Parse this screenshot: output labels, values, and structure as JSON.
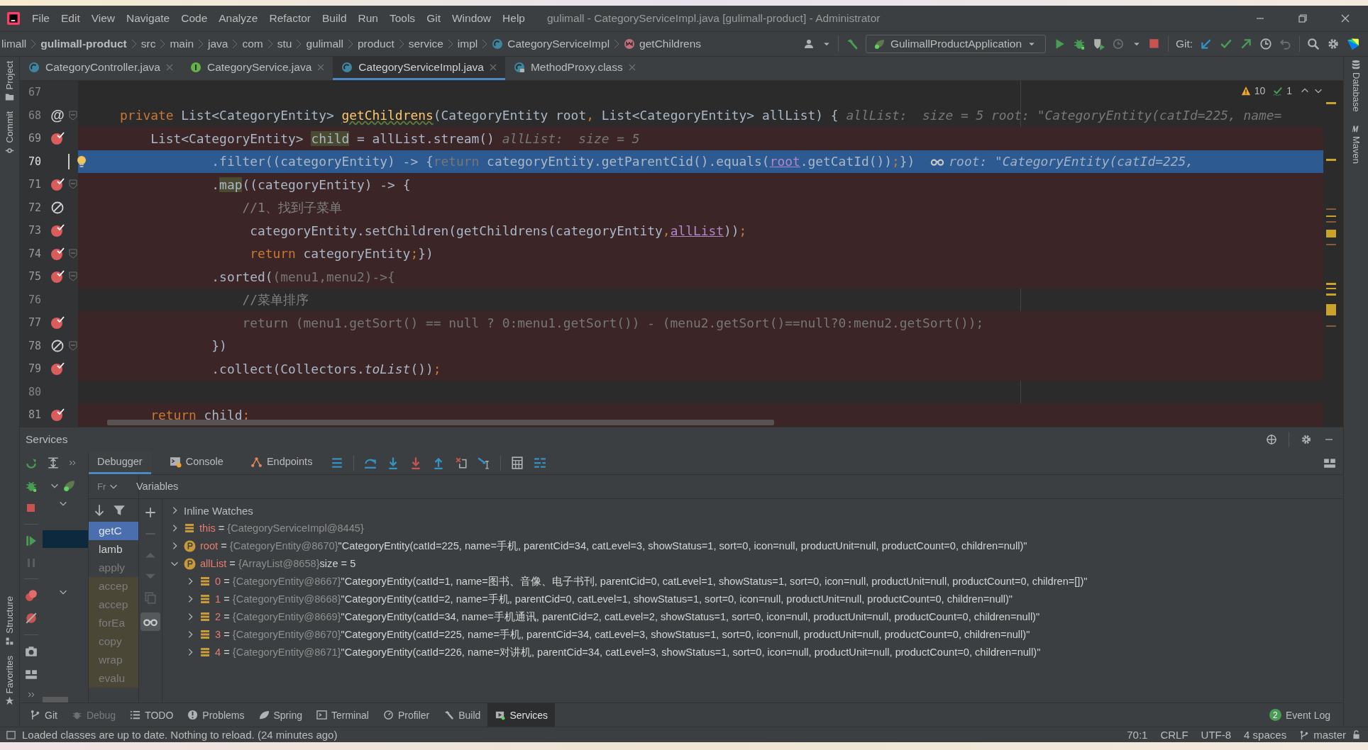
{
  "window": {
    "title": "gulimall - CategoryServiceImpl.java [gulimall-product] - Administrator"
  },
  "menu": [
    "File",
    "Edit",
    "View",
    "Navigate",
    "Code",
    "Analyze",
    "Refactor",
    "Build",
    "Run",
    "Tools",
    "Git",
    "Window",
    "Help"
  ],
  "breadcrumb": [
    {
      "label": "limall",
      "kind": "plain"
    },
    {
      "label": "gulimall-product",
      "kind": "module"
    },
    {
      "label": "src",
      "kind": "plain"
    },
    {
      "label": "main",
      "kind": "plain"
    },
    {
      "label": "java",
      "kind": "plain"
    },
    {
      "label": "com",
      "kind": "plain"
    },
    {
      "label": "stu",
      "kind": "plain"
    },
    {
      "label": "gulimall",
      "kind": "plain"
    },
    {
      "label": "product",
      "kind": "plain"
    },
    {
      "label": "service",
      "kind": "plain"
    },
    {
      "label": "impl",
      "kind": "plain"
    },
    {
      "label": "CategoryServiceImpl",
      "kind": "class"
    },
    {
      "label": "getChildrens",
      "kind": "method"
    }
  ],
  "run_config": "GulimallProductApplication",
  "git_label": "Git:",
  "left_tools": [
    "Project",
    "Commit"
  ],
  "left_tools_bottom": [
    "Structure",
    "Favorites"
  ],
  "right_tools": [
    {
      "label": "Database",
      "kind": "database"
    },
    {
      "label": "Maven",
      "kind": "maven"
    }
  ],
  "tabs": [
    {
      "label": "CategoryController.java",
      "kind": "class",
      "selected": false
    },
    {
      "label": "CategoryService.java",
      "kind": "interface",
      "selected": false
    },
    {
      "label": "CategoryServiceImpl.java",
      "kind": "class",
      "selected": true
    },
    {
      "label": "MethodProxy.class",
      "kind": "compiled",
      "selected": false
    }
  ],
  "inspections": {
    "warnings": "10",
    "passed": "1"
  },
  "code_lines": [
    {
      "number": "67",
      "current": false,
      "breakpoint": false,
      "fold": false,
      "bulb": false
    },
    {
      "number": "68",
      "current": false,
      "breakpoint": false,
      "fold": true,
      "bulb": false,
      "gutter_text": "@",
      "segments": [
        {
          "text": "    private ",
          "kind": "keyword"
        },
        {
          "text": "List<CategoryEntity> ",
          "kind": "plain"
        },
        {
          "text": "getChildrens",
          "kind": "decl"
        },
        {
          "text": "(CategoryEntity root",
          "kind": "plain"
        },
        {
          "text": ", ",
          "kind": "keyword"
        },
        {
          "text": "List<CategoryEntity> allList) {",
          "kind": "plain"
        },
        {
          "text": "allList:  size = 5",
          "kind": "hint"
        },
        {
          "text": "root: \"CategoryEntity(catId=225, name=",
          "kind": "hint"
        }
      ]
    },
    {
      "number": "69",
      "current": false,
      "breakpoint": true,
      "muted": false,
      "fold": false,
      "bulb": false,
      "segments": [
        {
          "text": "        List<CategoryEntity> ",
          "kind": "plain"
        },
        {
          "text": "child",
          "kind": "usage"
        },
        {
          "text": " = allList.stream()",
          "kind": "plain"
        },
        {
          "text": "allList:  size = 5",
          "kind": "hint"
        }
      ]
    },
    {
      "number": "70",
      "current": true,
      "breakpoint": false,
      "fold": false,
      "bulb": true,
      "segments": [
        {
          "text": "                .filter((categoryEntity) -> {",
          "kind": "plain"
        },
        {
          "text": "return",
          "kind": "dim"
        },
        {
          "text": " categoryEntity.getParentCid().equals(",
          "kind": "plain"
        },
        {
          "text": "root",
          "kind": "ref"
        },
        {
          "text": ".getCatId())",
          "kind": "plain"
        },
        {
          "text": ";",
          "kind": "keyword"
        },
        {
          "text": "})",
          "kind": "plain"
        },
        {
          "text": "root: \"CategoryEntity(catId=225,",
          "kind": "watch"
        }
      ]
    },
    {
      "number": "71",
      "current": false,
      "breakpoint": true,
      "muted": false,
      "fold": true,
      "bulb": false,
      "segments": [
        {
          "text": "                .",
          "kind": "plain"
        },
        {
          "text": "map",
          "kind": "usage"
        },
        {
          "text": "((categoryEntity) -> {",
          "kind": "plain"
        }
      ]
    },
    {
      "number": "72",
      "current": false,
      "breakpoint": true,
      "muted": true,
      "fold": false,
      "bulb": false,
      "segments": [
        {
          "text": "                    //1、找到子菜单",
          "kind": "comment"
        }
      ]
    },
    {
      "number": "73",
      "current": false,
      "breakpoint": true,
      "muted": false,
      "fold": false,
      "bulb": false,
      "segments": [
        {
          "text": "                     categoryEntity.setChildren(getChildrens(categoryEntity",
          "kind": "plain"
        },
        {
          "text": ",",
          "kind": "keyword"
        },
        {
          "text": "allList",
          "kind": "ref"
        },
        {
          "text": "))",
          "kind": "plain"
        },
        {
          "text": ";",
          "kind": "keyword"
        }
      ]
    },
    {
      "number": "74",
      "current": false,
      "breakpoint": true,
      "muted": false,
      "fold": true,
      "bulb": false,
      "segments": [
        {
          "text": "                     return ",
          "kind": "keyword"
        },
        {
          "text": "categoryEntity",
          "kind": "plain"
        },
        {
          "text": ";",
          "kind": "keyword"
        },
        {
          "text": "})",
          "kind": "plain"
        }
      ]
    },
    {
      "number": "75",
      "current": false,
      "breakpoint": true,
      "muted": false,
      "fold": true,
      "bulb": false,
      "segments": [
        {
          "text": "                .sorted(",
          "kind": "plain"
        },
        {
          "text": "(menu1,menu2)->{",
          "kind": "dim"
        }
      ]
    },
    {
      "number": "76",
      "current": false,
      "breakpoint": false,
      "fold": false,
      "bulb": false,
      "segments": [
        {
          "text": "                    //菜单排序",
          "kind": "comment"
        }
      ]
    },
    {
      "number": "77",
      "current": false,
      "breakpoint": true,
      "muted": false,
      "fold": false,
      "bulb": false,
      "segments": [
        {
          "text": "                    return (menu1.getSort() == null ? 0:menu1.getSort()) - (menu2.getSort()==null?0:menu2.getSort());",
          "kind": "dim"
        }
      ]
    },
    {
      "number": "78",
      "current": false,
      "breakpoint": true,
      "muted": true,
      "fold": true,
      "bulb": false,
      "segments": [
        {
          "text": "                })",
          "kind": "plain"
        }
      ]
    },
    {
      "number": "79",
      "current": false,
      "breakpoint": true,
      "muted": false,
      "fold": false,
      "bulb": false,
      "segments": [
        {
          "text": "                .collect(Collectors.",
          "kind": "plain"
        },
        {
          "text": "toList",
          "kind": "italic"
        },
        {
          "text": "())",
          "kind": "plain"
        },
        {
          "text": ";",
          "kind": "keyword"
        }
      ]
    },
    {
      "number": "80",
      "current": false,
      "breakpoint": false,
      "fold": false,
      "bulb": false
    },
    {
      "number": "81",
      "current": false,
      "breakpoint": true,
      "muted": false,
      "fold": false,
      "bulb": false,
      "segments": [
        {
          "text": "        return ",
          "kind": "keyword"
        },
        {
          "text": "child",
          "kind": "plain"
        },
        {
          "text": ";",
          "kind": "keyword"
        }
      ]
    }
  ],
  "services": {
    "title": "Services"
  },
  "debug_tabs": [
    {
      "label": "Debugger",
      "kind": "debugger",
      "selected": true
    },
    {
      "label": "Console",
      "kind": "console",
      "selected": false
    },
    {
      "label": "Endpoints",
      "kind": "endpoints",
      "selected": false
    }
  ],
  "frames_header": "Fr",
  "frames": [
    {
      "label": "getC",
      "selected": true,
      "library": false,
      "dimmed": false
    },
    {
      "label": "lamb",
      "selected": false,
      "library": false,
      "dimmed": false
    },
    {
      "label": "apply",
      "selected": false,
      "library": false,
      "dimmed": true
    },
    {
      "label": "accep",
      "selected": false,
      "library": true,
      "dimmed": true
    },
    {
      "label": "accep",
      "selected": false,
      "library": true,
      "dimmed": true
    },
    {
      "label": "forEa",
      "selected": false,
      "library": true,
      "dimmed": true
    },
    {
      "label": "copy",
      "selected": false,
      "library": true,
      "dimmed": true
    },
    {
      "label": "wrap",
      "selected": false,
      "library": true,
      "dimmed": true
    },
    {
      "label": "evalu",
      "selected": false,
      "library": true,
      "dimmed": true
    }
  ],
  "variables_title": "Variables",
  "variables": [
    {
      "name": "Inline Watches",
      "kind": "group",
      "expanded": false
    },
    {
      "name": "this",
      "kind": "field",
      "operator": "=",
      "type": "{CategoryServiceImpl@8445}",
      "expanded": false
    },
    {
      "name": "root",
      "kind": "param",
      "operator": "=",
      "type": "{CategoryEntity@8670}",
      "value": "\"CategoryEntity(catId=225, name=手机, parentCid=34, catLevel=3, showStatus=1, sort=0, icon=null, productUnit=null, productCount=0, children=null)\"",
      "expanded": false
    },
    {
      "name": "allList",
      "kind": "param",
      "operator": "=",
      "type": "{ArrayList@8658}",
      "value": "size = 5",
      "expanded": true,
      "children": [
        {
          "name": "0",
          "kind": "field",
          "operator": "=",
          "type": "{CategoryEntity@8667}",
          "value": "\"CategoryEntity(catId=1, name=图书、音像、电子书刊, parentCid=0, catLevel=1, showStatus=1, sort=0, icon=null, productUnit=null, productCount=0, children=[])\"",
          "expanded": false
        },
        {
          "name": "1",
          "kind": "field",
          "operator": "=",
          "type": "{CategoryEntity@8668}",
          "value": "\"CategoryEntity(catId=2, name=手机, parentCid=0, catLevel=1, showStatus=1, sort=0, icon=null, productUnit=null, productCount=0, children=null)\"",
          "expanded": false
        },
        {
          "name": "2",
          "kind": "field",
          "operator": "=",
          "type": "{CategoryEntity@8669}",
          "value": "\"CategoryEntity(catId=34, name=手机通讯, parentCid=2, catLevel=2, showStatus=1, sort=0, icon=null, productUnit=null, productCount=0, children=null)\"",
          "expanded": false
        },
        {
          "name": "3",
          "kind": "field",
          "operator": "=",
          "type": "{CategoryEntity@8670}",
          "value": "\"CategoryEntity(catId=225, name=手机, parentCid=34, catLevel=3, showStatus=1, sort=0, icon=null, productUnit=null, productCount=0, children=null)\"",
          "expanded": false
        },
        {
          "name": "4",
          "kind": "field",
          "operator": "=",
          "type": "{CategoryEntity@8671}",
          "value": "\"CategoryEntity(catId=226, name=对讲机, parentCid=34, catLevel=3, showStatus=1, sort=0, icon=null, productUnit=null, productCount=0, children=null)\"",
          "expanded": false
        }
      ]
    }
  ],
  "tool_windows": [
    {
      "label": "Git",
      "kind": "git",
      "selected": false,
      "disabled": false
    },
    {
      "label": "Debug",
      "kind": "debug",
      "selected": false,
      "disabled": true
    },
    {
      "label": "TODO",
      "kind": "todo",
      "selected": false,
      "disabled": false
    },
    {
      "label": "Problems",
      "kind": "problems",
      "selected": false,
      "disabled": false
    },
    {
      "label": "Spring",
      "kind": "spring",
      "selected": false,
      "disabled": false
    },
    {
      "label": "Terminal",
      "kind": "terminal",
      "selected": false,
      "disabled": false
    },
    {
      "label": "Profiler",
      "kind": "profiler",
      "selected": false,
      "disabled": false
    },
    {
      "label": "Build",
      "kind": "build",
      "selected": false,
      "disabled": false
    },
    {
      "label": "Services",
      "kind": "services",
      "selected": true,
      "disabled": false
    }
  ],
  "event_log": {
    "label": "Event Log",
    "count": "2"
  },
  "status_bar": {
    "message": "Loaded classes are up to date. Nothing to reload. (24 minutes ago)",
    "position": "70:1",
    "line_separator": "CRLF",
    "encoding": "UTF-8",
    "indent": "4 spaces",
    "branch": "master"
  }
}
